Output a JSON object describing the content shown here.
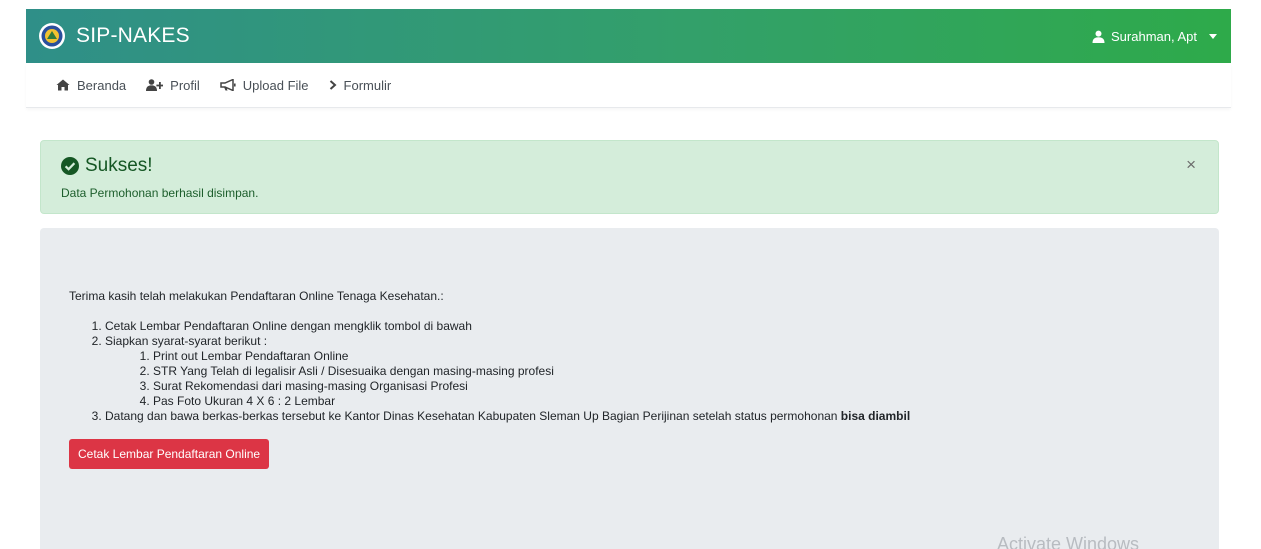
{
  "app": {
    "brand": "SIP-NAKES"
  },
  "user": {
    "name": "Surahman, Apt"
  },
  "nav": {
    "items": [
      {
        "label": "Beranda",
        "icon": "home-icon"
      },
      {
        "label": "Profil",
        "icon": "user-plus-icon"
      },
      {
        "label": "Upload File",
        "icon": "bullhorn-icon"
      },
      {
        "label": "Formulir",
        "icon": "chevron-right-icon"
      }
    ]
  },
  "alert": {
    "title": "Sukses!",
    "message": "Data Permohonan berhasil disimpan.",
    "close": "×"
  },
  "content": {
    "intro": "Terima kasih telah melakukan Pendaftaran Online Tenaga Kesehatan.:",
    "step1": "Cetak Lembar Pendaftaran Online dengan mengklik tombol di bawah",
    "step2": "Siapkan syarat-syarat berikut :",
    "requirements": [
      "Print out Lembar Pendaftaran Online",
      "STR Yang Telah di legalisir Asli / Disesuaika dengan masing-masing profesi",
      "Surat Rekomendasi dari masing-masing Organisasi Profesi",
      "Pas Foto Ukuran 4 X 6 : 2 Lembar"
    ],
    "step3_text": "Datang dan bawa berkas-berkas tersebut ke Kantor Dinas Kesehatan Kabupaten Sleman Up Bagian Perijinan setelah status permohonan ",
    "step3_bold": "bisa diambil",
    "button": "Cetak Lembar Pendaftaran Online"
  },
  "watermark": "Activate Windows",
  "colors": {
    "header_start": "#2f8f88",
    "header_end": "#2eaa4a",
    "success_bg": "#d4edda",
    "success_text": "#155724",
    "button_red": "#dc3545",
    "panel_bg": "#e9ecef"
  }
}
